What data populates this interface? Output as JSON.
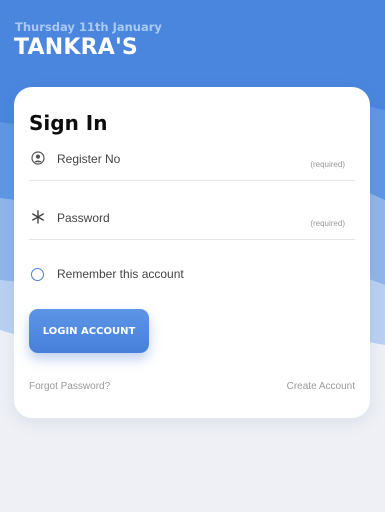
{
  "header": {
    "date": "Thursday 11th January",
    "title": "TANKRA'S"
  },
  "colors": {
    "header_blue": "#4a86de",
    "accent": "#4a7ed8",
    "background": "#eef0f5"
  },
  "signin": {
    "title": "Sign In",
    "fields": [
      {
        "label": "Register No",
        "hint": "(required)",
        "icon": "user-circle-icon"
      },
      {
        "label": "Password",
        "hint": "(required)",
        "icon": "asterisk-icon"
      }
    ],
    "remember_label": "Remember this account",
    "login_button": "LOGIN ACCOUNT",
    "forgot_link": "Forgot Password?",
    "create_link": "Create Account"
  }
}
